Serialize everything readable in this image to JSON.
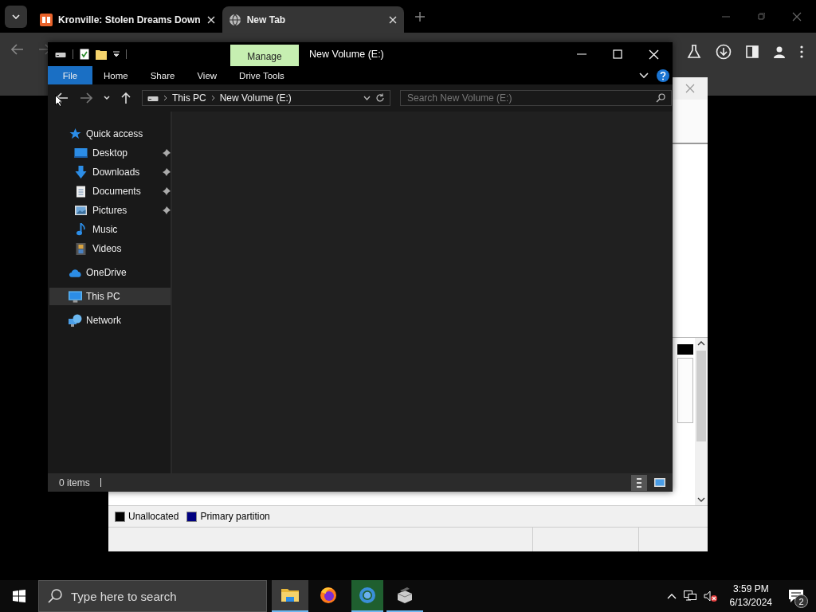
{
  "browser": {
    "tabs": [
      {
        "title": "Kronville: Stolen Dreams Down",
        "selected": false
      },
      {
        "title": "New Tab",
        "selected": true
      }
    ]
  },
  "background_window": {
    "legend": [
      {
        "label": "Unallocated",
        "color": "#000000"
      },
      {
        "label": "Primary partition",
        "color": "#000080"
      }
    ]
  },
  "explorer": {
    "title": "New Volume (E:)",
    "context_tab": "Manage",
    "ribbon_tabs": [
      {
        "label": "File",
        "kind": "file"
      },
      {
        "label": "Home",
        "kind": "tab"
      },
      {
        "label": "Share",
        "kind": "tab"
      },
      {
        "label": "View",
        "kind": "tab"
      },
      {
        "label": "Drive Tools",
        "kind": "context"
      }
    ],
    "breadcrumbs": [
      "This PC",
      "New Volume (E:)"
    ],
    "search": {
      "placeholder": "Search New Volume (E:)"
    },
    "nav": [
      {
        "label": "Quick access",
        "kind": "star",
        "selected": false,
        "children": [
          {
            "label": "Desktop",
            "kind": "desktop",
            "pinned": true,
            "selected": false
          },
          {
            "label": "Downloads",
            "kind": "download",
            "pinned": true,
            "selected": false
          },
          {
            "label": "Documents",
            "kind": "document",
            "pinned": true,
            "selected": false
          },
          {
            "label": "Pictures",
            "kind": "pictures",
            "pinned": true,
            "selected": false
          },
          {
            "label": "Music",
            "kind": "music",
            "pinned": false,
            "selected": false
          },
          {
            "label": "Videos",
            "kind": "videos",
            "pinned": false,
            "selected": false
          }
        ]
      },
      {
        "label": "OneDrive",
        "kind": "cloud",
        "selected": false
      },
      {
        "label": "This PC",
        "kind": "pc",
        "selected": true
      },
      {
        "label": "Network",
        "kind": "network",
        "selected": false
      }
    ],
    "status": "0 items"
  },
  "taskbar": {
    "search": {
      "placeholder": "Type here to search"
    },
    "apps": [
      {
        "kind": "explorer",
        "running": true,
        "active": true,
        "flashing": false
      },
      {
        "kind": "firefox",
        "running": false,
        "active": false,
        "flashing": false
      },
      {
        "kind": "chrome",
        "running": true,
        "active": false,
        "flashing": true
      },
      {
        "kind": "installer",
        "running": true,
        "active": false,
        "flashing": false
      }
    ],
    "time": "3:59 PM",
    "date": "6/13/2024",
    "notifications": "2"
  }
}
